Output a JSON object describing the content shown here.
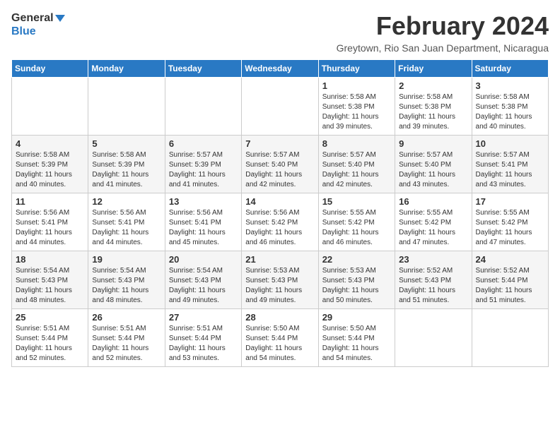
{
  "logo": {
    "line1": "General",
    "line2": "Blue"
  },
  "title": "February 2024",
  "subtitle": "Greytown, Rio San Juan Department, Nicaragua",
  "days_of_week": [
    "Sunday",
    "Monday",
    "Tuesday",
    "Wednesday",
    "Thursday",
    "Friday",
    "Saturday"
  ],
  "weeks": [
    [
      {
        "day": "",
        "info": ""
      },
      {
        "day": "",
        "info": ""
      },
      {
        "day": "",
        "info": ""
      },
      {
        "day": "",
        "info": ""
      },
      {
        "day": "1",
        "info": "Sunrise: 5:58 AM\nSunset: 5:38 PM\nDaylight: 11 hours and 39 minutes."
      },
      {
        "day": "2",
        "info": "Sunrise: 5:58 AM\nSunset: 5:38 PM\nDaylight: 11 hours and 39 minutes."
      },
      {
        "day": "3",
        "info": "Sunrise: 5:58 AM\nSunset: 5:38 PM\nDaylight: 11 hours and 40 minutes."
      }
    ],
    [
      {
        "day": "4",
        "info": "Sunrise: 5:58 AM\nSunset: 5:39 PM\nDaylight: 11 hours and 40 minutes."
      },
      {
        "day": "5",
        "info": "Sunrise: 5:58 AM\nSunset: 5:39 PM\nDaylight: 11 hours and 41 minutes."
      },
      {
        "day": "6",
        "info": "Sunrise: 5:57 AM\nSunset: 5:39 PM\nDaylight: 11 hours and 41 minutes."
      },
      {
        "day": "7",
        "info": "Sunrise: 5:57 AM\nSunset: 5:40 PM\nDaylight: 11 hours and 42 minutes."
      },
      {
        "day": "8",
        "info": "Sunrise: 5:57 AM\nSunset: 5:40 PM\nDaylight: 11 hours and 42 minutes."
      },
      {
        "day": "9",
        "info": "Sunrise: 5:57 AM\nSunset: 5:40 PM\nDaylight: 11 hours and 43 minutes."
      },
      {
        "day": "10",
        "info": "Sunrise: 5:57 AM\nSunset: 5:41 PM\nDaylight: 11 hours and 43 minutes."
      }
    ],
    [
      {
        "day": "11",
        "info": "Sunrise: 5:56 AM\nSunset: 5:41 PM\nDaylight: 11 hours and 44 minutes."
      },
      {
        "day": "12",
        "info": "Sunrise: 5:56 AM\nSunset: 5:41 PM\nDaylight: 11 hours and 44 minutes."
      },
      {
        "day": "13",
        "info": "Sunrise: 5:56 AM\nSunset: 5:41 PM\nDaylight: 11 hours and 45 minutes."
      },
      {
        "day": "14",
        "info": "Sunrise: 5:56 AM\nSunset: 5:42 PM\nDaylight: 11 hours and 46 minutes."
      },
      {
        "day": "15",
        "info": "Sunrise: 5:55 AM\nSunset: 5:42 PM\nDaylight: 11 hours and 46 minutes."
      },
      {
        "day": "16",
        "info": "Sunrise: 5:55 AM\nSunset: 5:42 PM\nDaylight: 11 hours and 47 minutes."
      },
      {
        "day": "17",
        "info": "Sunrise: 5:55 AM\nSunset: 5:42 PM\nDaylight: 11 hours and 47 minutes."
      }
    ],
    [
      {
        "day": "18",
        "info": "Sunrise: 5:54 AM\nSunset: 5:43 PM\nDaylight: 11 hours and 48 minutes."
      },
      {
        "day": "19",
        "info": "Sunrise: 5:54 AM\nSunset: 5:43 PM\nDaylight: 11 hours and 48 minutes."
      },
      {
        "day": "20",
        "info": "Sunrise: 5:54 AM\nSunset: 5:43 PM\nDaylight: 11 hours and 49 minutes."
      },
      {
        "day": "21",
        "info": "Sunrise: 5:53 AM\nSunset: 5:43 PM\nDaylight: 11 hours and 49 minutes."
      },
      {
        "day": "22",
        "info": "Sunrise: 5:53 AM\nSunset: 5:43 PM\nDaylight: 11 hours and 50 minutes."
      },
      {
        "day": "23",
        "info": "Sunrise: 5:52 AM\nSunset: 5:43 PM\nDaylight: 11 hours and 51 minutes."
      },
      {
        "day": "24",
        "info": "Sunrise: 5:52 AM\nSunset: 5:44 PM\nDaylight: 11 hours and 51 minutes."
      }
    ],
    [
      {
        "day": "25",
        "info": "Sunrise: 5:51 AM\nSunset: 5:44 PM\nDaylight: 11 hours and 52 minutes."
      },
      {
        "day": "26",
        "info": "Sunrise: 5:51 AM\nSunset: 5:44 PM\nDaylight: 11 hours and 52 minutes."
      },
      {
        "day": "27",
        "info": "Sunrise: 5:51 AM\nSunset: 5:44 PM\nDaylight: 11 hours and 53 minutes."
      },
      {
        "day": "28",
        "info": "Sunrise: 5:50 AM\nSunset: 5:44 PM\nDaylight: 11 hours and 54 minutes."
      },
      {
        "day": "29",
        "info": "Sunrise: 5:50 AM\nSunset: 5:44 PM\nDaylight: 11 hours and 54 minutes."
      },
      {
        "day": "",
        "info": ""
      },
      {
        "day": "",
        "info": ""
      }
    ]
  ]
}
